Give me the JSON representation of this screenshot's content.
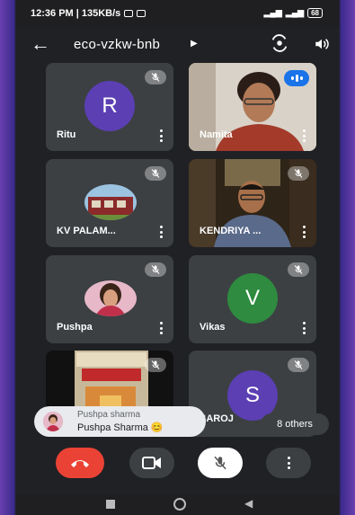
{
  "status_bar": {
    "time_speed": "12:36 PM | 135KB/s",
    "battery": "68"
  },
  "header": {
    "meeting_code": "eco-vzkw-bnb",
    "back_icon": "arrow-back-icon",
    "camera_switch_icon": "camera-switch-icon",
    "speaker_icon": "speaker-icon"
  },
  "participants": [
    {
      "name": "Ritu",
      "avatar_letter": "R",
      "avatar_color": "#5b3fb3",
      "muted": true
    },
    {
      "name": "Namita",
      "video": true,
      "speaking": true
    },
    {
      "name": "KV PALAM...",
      "avatar_type": "photo",
      "muted": true
    },
    {
      "name": "KENDRIYA ...",
      "video": true,
      "muted": true
    },
    {
      "name": "Pushpa",
      "avatar_type": "photo",
      "muted": true
    },
    {
      "name": "Vikas",
      "avatar_letter": "V",
      "avatar_color": "#2e8b3f",
      "muted": true
    },
    {
      "name": "",
      "video": true,
      "muted": true
    },
    {
      "name": "SAROJ",
      "avatar_letter": "S",
      "avatar_color": "#5b3fb3",
      "muted": true
    }
  ],
  "chat_popup": {
    "sender": "Pushpa sharma",
    "message": "Pushpa Sharma 😊"
  },
  "others_chip": "8 others",
  "controls": {
    "end_call_color": "#ea4335",
    "mic_muted_bg": "#ffffff"
  }
}
